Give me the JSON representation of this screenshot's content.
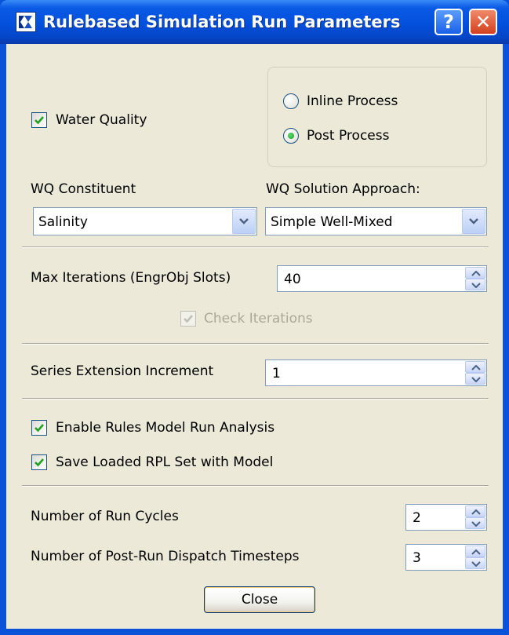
{
  "window": {
    "title": "Rulebased Simulation Run Parameters",
    "help_label": "?",
    "close_label": "✕"
  },
  "water_quality": {
    "label": "Water Quality",
    "checked": true,
    "process_options": [
      {
        "label": "Inline Process",
        "selected": false
      },
      {
        "label": "Post Process",
        "selected": true
      }
    ]
  },
  "wq_constituent": {
    "label": "WQ Constituent",
    "value": "Salinity"
  },
  "wq_solution": {
    "label": "WQ Solution Approach:",
    "value": "Simple Well-Mixed"
  },
  "max_iterations": {
    "label": "Max Iterations  (EngrObj Slots)",
    "value": "40",
    "check_label": "Check Iterations",
    "check_checked": true,
    "check_enabled": false
  },
  "series_extension": {
    "label": "Series Extension Increment",
    "value": "1"
  },
  "options": {
    "enable_analysis_label": "Enable Rules Model Run Analysis",
    "enable_analysis_checked": true,
    "save_rpl_label": "Save Loaded RPL Set with Model",
    "save_rpl_checked": true
  },
  "run_cycles": {
    "label": "Number of Run Cycles",
    "value": "2"
  },
  "dispatch_timesteps": {
    "label": "Number of Post-Run Dispatch Timesteps",
    "value": "3"
  },
  "buttons": {
    "close_label": "Close"
  },
  "colors": {
    "titlebar": "#0350dc",
    "dialog_bg": "#ece9d8",
    "check_green": "#21a121"
  },
  "icons": [
    "app-icon",
    "help-icon",
    "close-icon",
    "checkmark-icon",
    "radio-dot-icon",
    "dropdown-arrow-icon",
    "spinner-up-icon",
    "spinner-down-icon"
  ]
}
